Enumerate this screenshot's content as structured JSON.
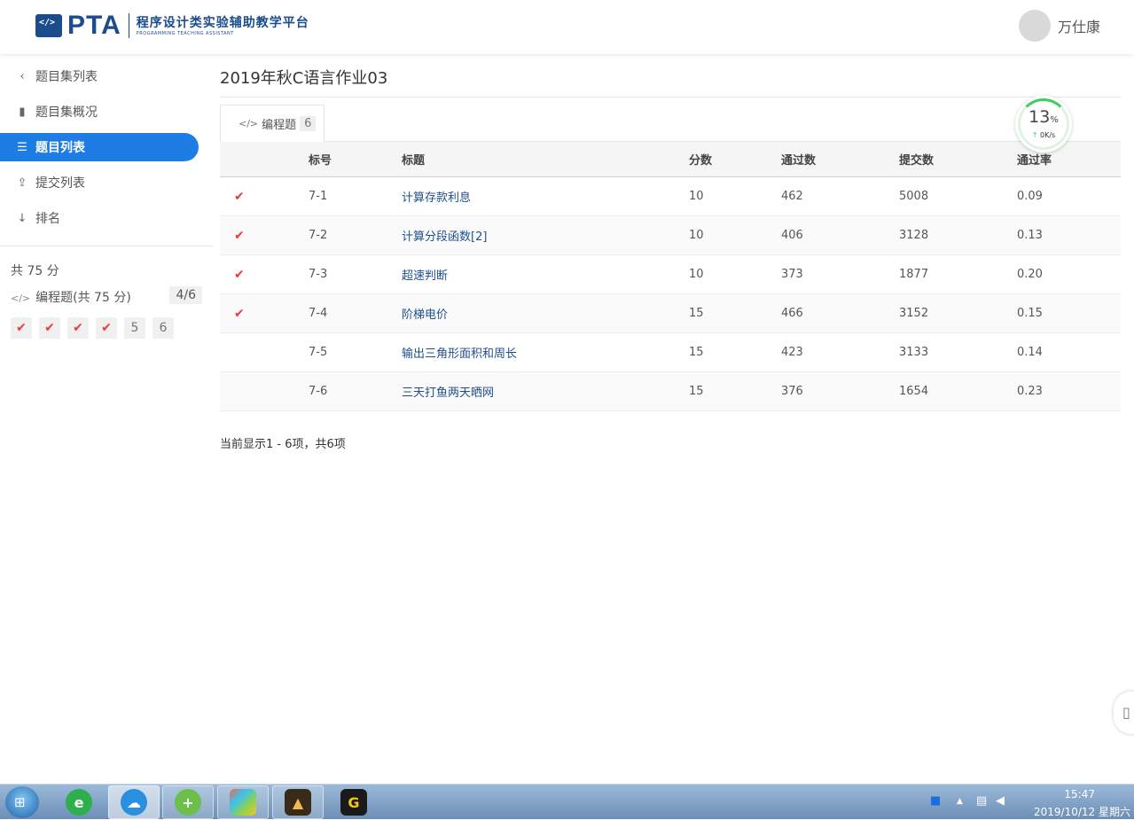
{
  "header": {
    "logo_text": "PTA",
    "logo_cn": "程序设计类实验辅助教学平台",
    "logo_en": "PROGRAMMING TEACHING ASSISTANT",
    "username": "万仕康"
  },
  "sidebar": {
    "items": [
      {
        "label": "题目集列表",
        "icon": "chevron-left-icon"
      },
      {
        "label": "题目集概况",
        "icon": "book-icon"
      },
      {
        "label": "题目列表",
        "icon": "list-icon",
        "active": true
      },
      {
        "label": "提交列表",
        "icon": "upload-icon"
      },
      {
        "label": "排名",
        "icon": "sort-icon"
      }
    ],
    "total_label": "共 75 分",
    "category_label": "编程题(共 75 分)",
    "category_count": "4/6",
    "problems": [
      {
        "label": "✔",
        "done": true
      },
      {
        "label": "✔",
        "done": true
      },
      {
        "label": "✔",
        "done": true
      },
      {
        "label": "✔",
        "done": true
      },
      {
        "label": "5",
        "done": false
      },
      {
        "label": "6",
        "done": false
      }
    ]
  },
  "main": {
    "title": "2019年秋C语言作业03",
    "tab_label": "编程题",
    "tab_count": "6",
    "columns": [
      "标号",
      "标题",
      "分数",
      "通过数",
      "提交数",
      "通过率"
    ],
    "rows": [
      {
        "solved": true,
        "num": "7-1",
        "title": "计算存款利息",
        "score": "10",
        "passed": "462",
        "submitted": "5008",
        "rate": "0.09"
      },
      {
        "solved": true,
        "num": "7-2",
        "title": "计算分段函数[2]",
        "score": "10",
        "passed": "406",
        "submitted": "3128",
        "rate": "0.13"
      },
      {
        "solved": true,
        "num": "7-3",
        "title": "超速判断",
        "score": "10",
        "passed": "373",
        "submitted": "1877",
        "rate": "0.20"
      },
      {
        "solved": true,
        "num": "7-4",
        "title": "阶梯电价",
        "score": "15",
        "passed": "466",
        "submitted": "3152",
        "rate": "0.15"
      },
      {
        "solved": false,
        "num": "7-5",
        "title": "输出三角形面积和周长",
        "score": "15",
        "passed": "423",
        "submitted": "3133",
        "rate": "0.14"
      },
      {
        "solved": false,
        "num": "7-6",
        "title": "三天打鱼两天晒网",
        "score": "15",
        "passed": "376",
        "submitted": "1654",
        "rate": "0.23"
      }
    ],
    "footer": "当前显示1 - 6项，共6项"
  },
  "speed_widget": {
    "percent": "13",
    "percent_unit": "%",
    "rate": "0K/s"
  },
  "taskbar": {
    "time": "15:47",
    "date": "2019/10/12 星期六"
  },
  "colors": {
    "brand": "#1b4d8c",
    "accent": "#1d7de5",
    "check": "#e83b3b",
    "link": "#1d4f8f"
  }
}
